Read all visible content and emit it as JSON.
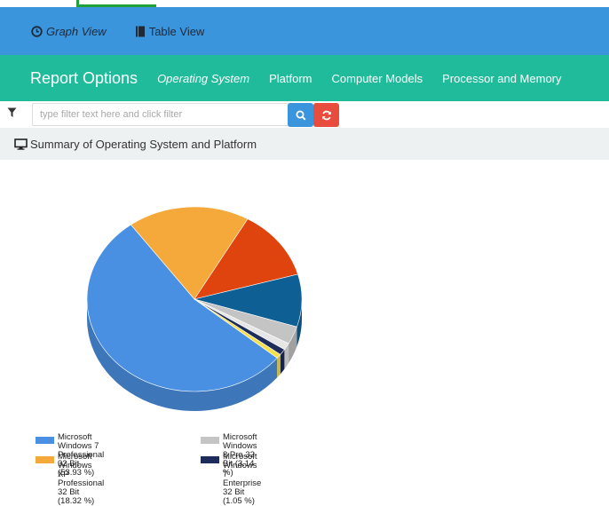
{
  "views": {
    "graph": {
      "label": "Graph View",
      "icon": "clock-icon"
    },
    "table": {
      "label": "Table View",
      "icon": "book-icon"
    }
  },
  "nav": {
    "title": "Report Options",
    "items": [
      {
        "label": "Operating System",
        "active": true
      },
      {
        "label": "Platform"
      },
      {
        "label": "Computer Models"
      },
      {
        "label": "Processor and Memory"
      }
    ]
  },
  "filter": {
    "placeholder": "type filter text here and click filter",
    "value": ""
  },
  "summary": {
    "title": "Summary of Operating System and Platform",
    "icon": "monitor-icon"
  },
  "colors": {
    "viewbar": "#3a95dd",
    "navbar": "#1fbb9a",
    "search_button": "#3a95dd",
    "reset_button": "#e74c3c"
  },
  "chart_data": {
    "type": "pie",
    "slices": [
      {
        "label": "Microsoft Windows 7 Professional 32 Bit (53.93 %)",
        "value": 53.93,
        "color": "#4a90e2"
      },
      {
        "label": "Microsoft Windows XP Professional 32 Bit (18.32 %)",
        "value": 18.32,
        "color": "#f5a93b"
      },
      {
        "label": "",
        "value": 12.4,
        "color": "#e0440e"
      },
      {
        "label": "",
        "value": 9.2,
        "color": "#0e5f94"
      },
      {
        "label": "Microsoft Windows 8 Pro 32 Bit (3.14 %)",
        "value": 3.14,
        "color": "#c4c4c4"
      },
      {
        "label": "",
        "value": 1.2,
        "color": "#e6e6e6"
      },
      {
        "label": "Microsoft Windows 7 Enterprise 32 Bit (1.05 %)",
        "value": 1.05,
        "color": "#1d2c5a"
      },
      {
        "label": "",
        "value": 0.76,
        "color": "#f4e04d"
      }
    ],
    "legend": [
      {
        "line1": "Microsoft Windows 7 Professional",
        "line2": "32 Bit (53.93 %)",
        "color": "#4a90e2"
      },
      {
        "line1": "Microsoft Windows 8 Pro 32",
        "line2": "Bit (3.14 %)",
        "color": "#c4c4c4"
      },
      {
        "line1": "Microsoft Windows XP Professional",
        "line2": "32 Bit (18.32 %)",
        "color": "#f5a93b"
      },
      {
        "line1": "Microsoft Windows 7 Enterprise",
        "line2": "32 Bit (1.05 %)",
        "color": "#1d2c5a"
      }
    ]
  }
}
